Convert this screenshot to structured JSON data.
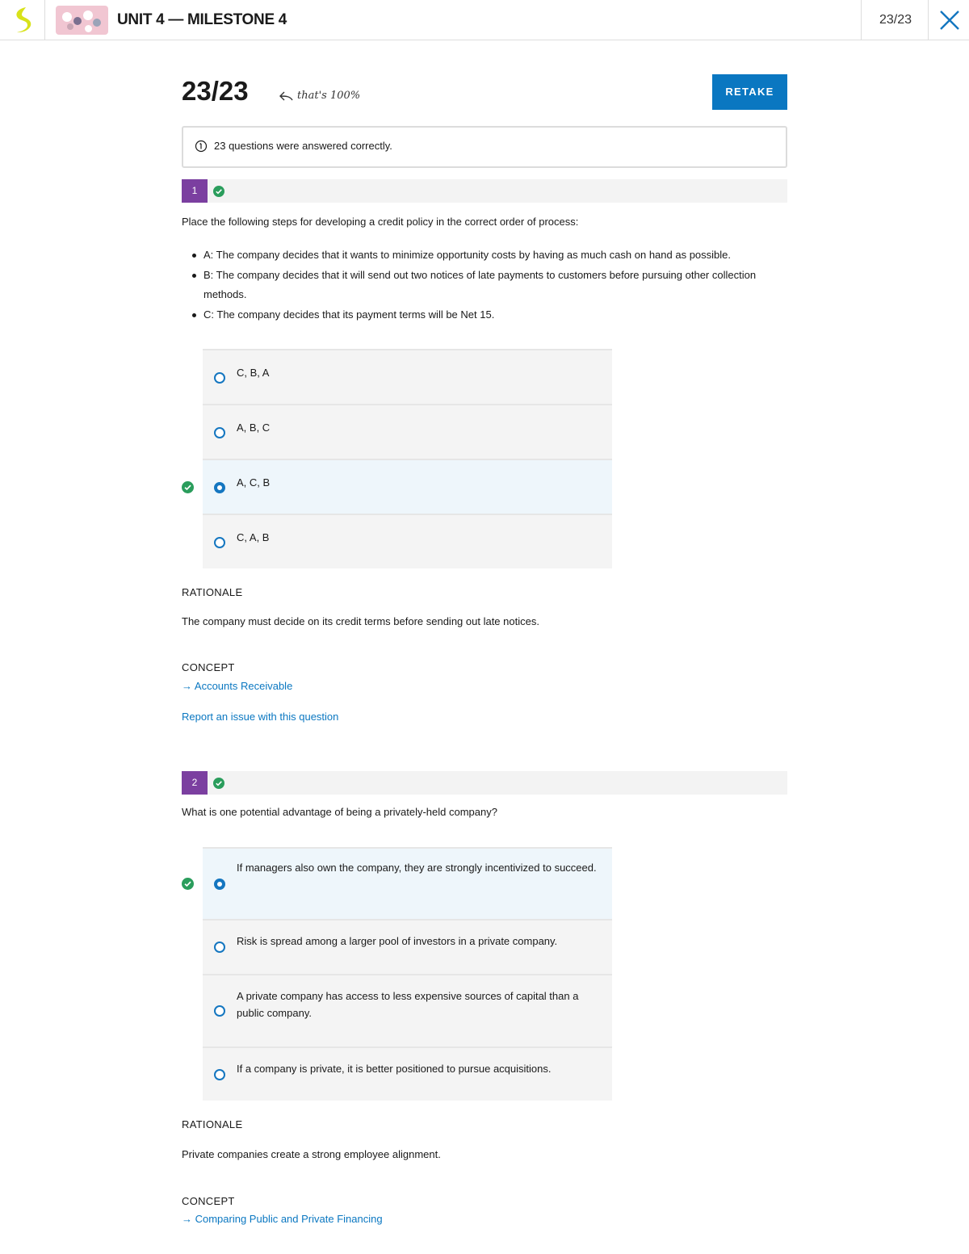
{
  "header": {
    "unit_title": "UNIT 4 — MILESTONE 4",
    "score": "23/23"
  },
  "summary": {
    "score": "23/23",
    "percent_note": "that's 100%",
    "retake_label": "RETAKE",
    "info_text": "23 questions were answered correctly."
  },
  "questions": [
    {
      "number": "1",
      "prompt": "Place the following steps for developing a credit policy in the correct order of process:",
      "items": [
        "A: The company decides that it wants to minimize opportunity costs by having as much cash on hand as possible.",
        "B: The company decides that it will send out two notices of late payments to customers before pursuing other collection methods.",
        "C: The company decides that its payment terms will be Net 15."
      ],
      "options": [
        "C, B, A",
        "A, B, C",
        "A, C, B",
        "C, A, B"
      ],
      "selected_index": 2,
      "rationale_heading": "RATIONALE",
      "rationale": "The company must decide on its credit terms before sending out late notices.",
      "concept_heading": "CONCEPT",
      "concept_link": "→ Accounts Receivable",
      "report_link": "Report an issue with this question"
    },
    {
      "number": "2",
      "prompt": "What is one potential advantage of being a privately-held company?",
      "options": [
        "If managers also own the company, they are strongly incentivized to succeed.",
        "Risk is spread among a larger pool of investors in a private company.",
        "A private company has access to less expensive sources of capital than a public company.",
        "If a company is private, it is better positioned to pursue acquisitions."
      ],
      "selected_index": 0,
      "rationale_heading": "RATIONALE",
      "rationale": "Private companies create a strong employee alignment.",
      "concept_heading": "CONCEPT",
      "concept_link": "→ Comparing Public and Private Financing"
    }
  ],
  "colors": {
    "accent_blue": "#0a77c1",
    "question_badge": "#7b3fa0",
    "correct_green": "#2a9d5c",
    "logo_yellow": "#d8e21a"
  }
}
